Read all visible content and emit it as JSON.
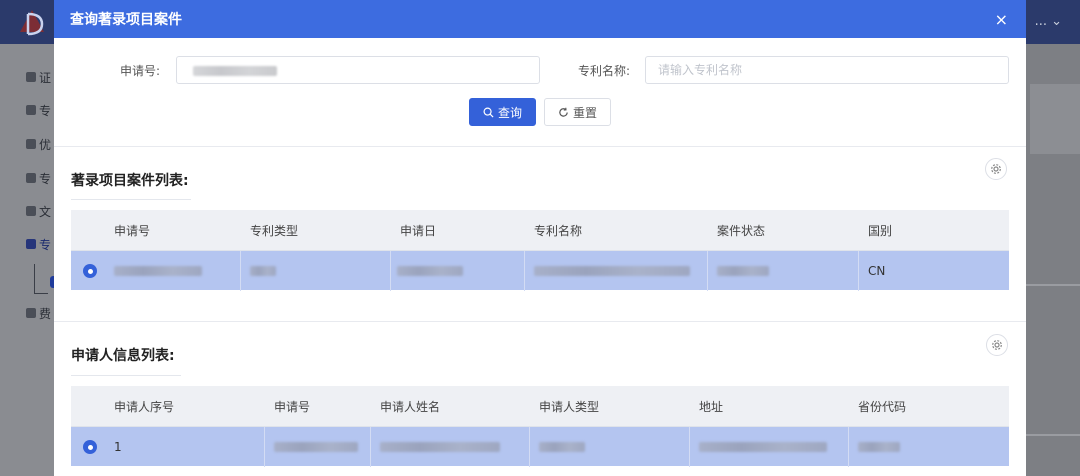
{
  "app": {
    "header_right_text": "... ⌄",
    "sidebar_items": [
      "证",
      "专",
      "优",
      "专",
      "文",
      "专",
      "费"
    ]
  },
  "modal": {
    "title": "查询著录项目案件",
    "close_icon": "close-icon",
    "close_label": "×"
  },
  "search": {
    "application_no_label": "申请号:",
    "application_no_value": "",
    "patent_name_label": "专利名称:",
    "patent_name_placeholder": "请输入专利名称",
    "query_label": "查询",
    "query_icon": "search-icon",
    "reset_label": "重置",
    "reset_icon": "refresh-icon"
  },
  "case_list": {
    "title": "著录项目案件列表:",
    "settings_icon": "gear-icon",
    "columns": [
      "申请号",
      "专利类型",
      "申请日",
      "专利名称",
      "案件状态",
      "国别"
    ],
    "rows": [
      {
        "selected": true,
        "country": "CN"
      }
    ]
  },
  "applicant_list": {
    "title": "申请人信息列表:",
    "settings_icon": "gear-icon",
    "columns": [
      "申请人序号",
      "申请号",
      "申请人姓名",
      "申请人类型",
      "地址",
      "省份代码"
    ],
    "rows": [
      {
        "selected": true,
        "seq": "1"
      }
    ]
  },
  "colors": {
    "header_blue": "#3d6ce0",
    "primary_button": "#3461d9",
    "selected_row": "#b4c5f0",
    "table_header": "#eef0f4"
  }
}
